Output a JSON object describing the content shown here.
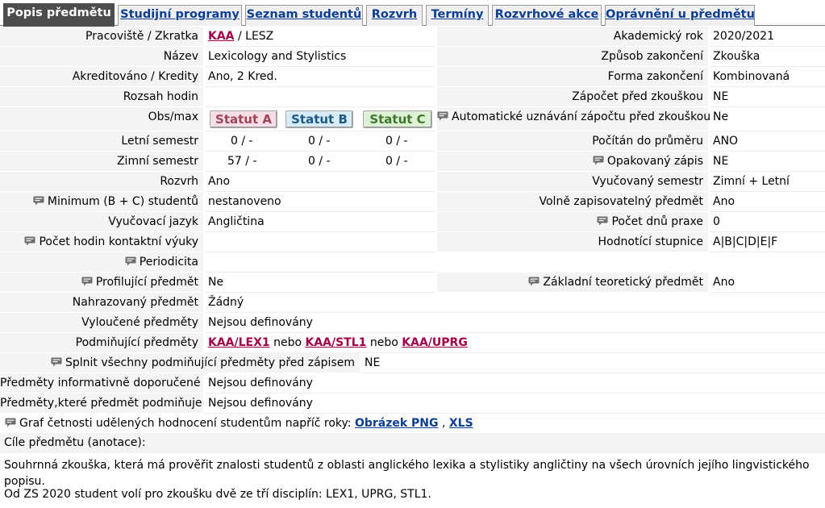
{
  "tabs": [
    {
      "label": "Popis předmětu",
      "active": true
    },
    {
      "label": "Studijní programy"
    },
    {
      "label": "Seznam studentů"
    },
    {
      "label": "Rozvrh"
    },
    {
      "label": "Termíny"
    },
    {
      "label": "Rozvrhové akce"
    },
    {
      "label": "Oprávnění u předmětu"
    }
  ],
  "left": {
    "pracoviste_label": "Pracoviště / Zkratka",
    "pracoviste_link": "KAA",
    "pracoviste_rest": " / LESZ",
    "nazev_label": "Název",
    "nazev_value": "Lexicology and Stylistics",
    "akred_label": "Akreditováno / Kredity",
    "akred_value": "Ano, 2 Kred.",
    "rozsah_label": "Rozsah hodin",
    "obsmax_label": "Obs/max",
    "statut_a": "Statut A",
    "statut_b": "Statut B",
    "statut_c": "Statut C",
    "letni_label": "Letní semestr",
    "letni_a": "0 / -",
    "letni_b": "0 / -",
    "letni_c": "0 / -",
    "zimni_label": "Zimní semestr",
    "zimni_a": "57 / -",
    "zimni_b": "0 / -",
    "zimni_c": "0 / -",
    "rozvrh_label": "Rozvrh",
    "rozvrh_value": "Ano",
    "minimum_label": "Minimum (B + C) studentů",
    "minimum_value": "nestanoveno",
    "jazyk_label": "Vyučovací jazyk",
    "jazyk_value": "Angličtina",
    "kontakt_label": "Počet hodin kontaktní výuky",
    "periodicita_label": "Periodicita",
    "profil_label": "Profilující předmět",
    "profil_value": "Ne"
  },
  "right": {
    "akadrok_label": "Akademický rok",
    "akadrok_value": "2020/2021",
    "zpusob_label": "Způsob zakončení",
    "zpusob_value": "Zkouška",
    "forma_label": "Forma zakončení",
    "forma_value": "Kombinovaná",
    "zapocet_label": "Zápočet před zkouškou",
    "zapocet_value": "NE",
    "auto_label": "Automatické uznávání zápočtu před zkouškou",
    "auto_value": "Ne",
    "prumer_label": "Počítán do průměru",
    "prumer_value": "ANO",
    "opak_label": "Opakovaný zápis",
    "opak_value": "NE",
    "vyuc_label": "Vyučovaný semestr",
    "vyuc_value": "Zimní + Letní",
    "volne_label": "Volně zapisovatelný předmět",
    "volne_value": "Ano",
    "praxe_label": "Počet dnů praxe",
    "praxe_value": "0",
    "hodn_label": "Hodnotící stupnice",
    "hodn_value": "A|B|C|D|E|F",
    "zaklad_label": "Základní teoretický předmět",
    "zaklad_value": "Ano"
  },
  "lower": {
    "nahraz_label": "Nahrazovaný předmět",
    "nahraz_value": "Žádný",
    "vylouc_label": "Vyloučené předměty",
    "vylouc_value": "Nejsou definovány",
    "podmin_label": "Podmiňující předměty",
    "podmin_link1": "KAA/LEX1",
    "podmin_or1": " nebo ",
    "podmin_link2": "KAA/STL1",
    "podmin_or2": " nebo ",
    "podmin_link3": "KAA/UPRG",
    "splnit_label": "Splnit všechny podmiňující předměty před zápisem",
    "splnit_value": "NE",
    "inform_label": "Předměty informativně doporučené",
    "inform_value": "Nejsou definovány",
    "ktere_label": "Předměty,které předmět podmiňuje",
    "ktere_value": "Nejsou definovány",
    "graf_label": "Graf četnosti udělených hodnocení studentům napříč roky:",
    "graf_png": "Obrázek PNG",
    "graf_sep": " , ",
    "graf_xls": "XLS"
  },
  "annotation": {
    "heading": "Cíle předmětu (anotace):",
    "para1": "Souhrnná zkouška, která má prověřit znalosti studentů z oblasti anglického lexika a stylistiky angličtiny na všech úrovních jejího lingvistického popisu.",
    "para2": "Od ZS 2020 student volí pro zkoušku dvě ze tří disciplín: LEX1, UPRG, STL1."
  },
  "colors": {
    "active_tab": "#4d4d4d",
    "tab_link": "#0b3d91",
    "course_link": "#a0004a",
    "statut_a_bg": "#f6dfe4",
    "statut_b_bg": "#d7ecf6",
    "statut_c_bg": "#dff0d8"
  },
  "icons": {
    "comment": "speech-bubble-icon"
  }
}
